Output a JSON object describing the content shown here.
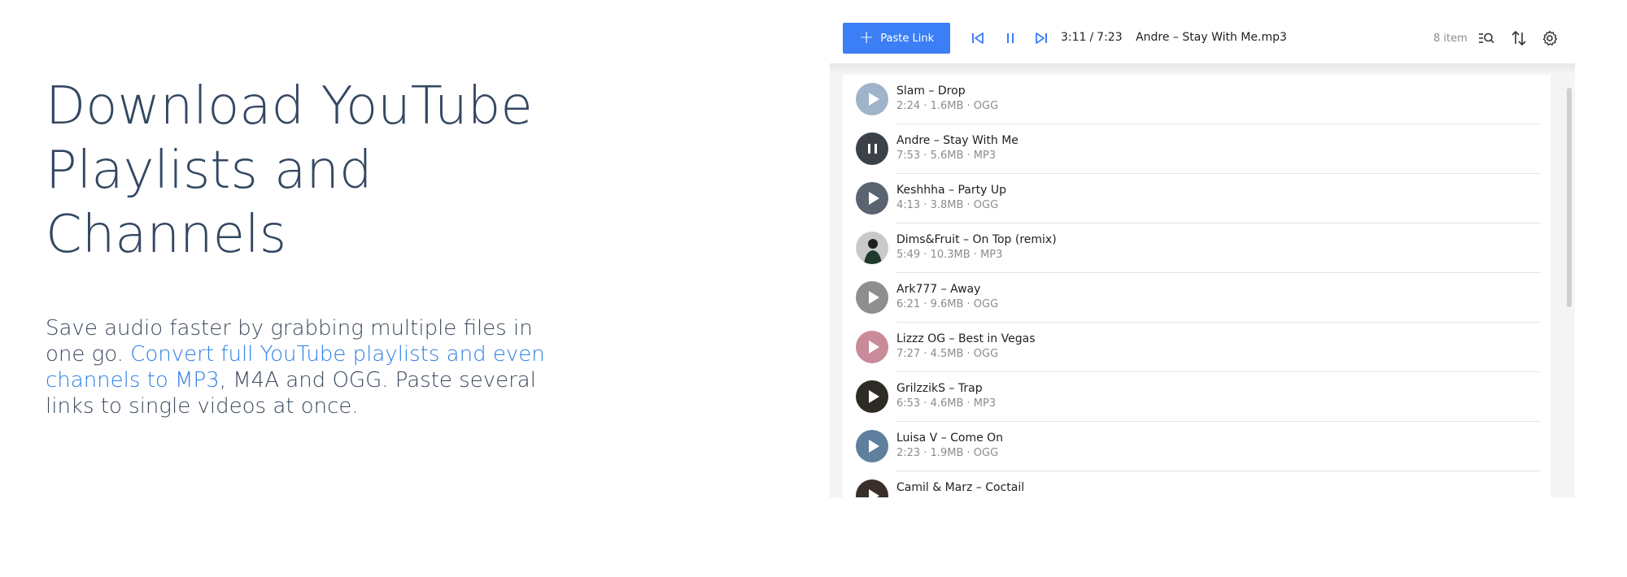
{
  "hero": {
    "title": "Download YouTube Playlists and Channels",
    "text_before": "Save audio faster by grabbing multiple files in one go. ",
    "link_text": "Convert full YouTube playlists and even channels to MP3",
    "text_after": ", M4A and OGG. Paste several links to single videos at once."
  },
  "toolbar": {
    "paste_label": "Paste Link",
    "current_time": "3:11",
    "total_time": "7:23",
    "now_playing": "Andre – Stay With Me.mp3",
    "item_count": "8 item",
    "icons": [
      "previous-icon",
      "pause-icon",
      "next-icon",
      "search-list-icon",
      "sort-icon",
      "gear-icon"
    ]
  },
  "colors": {
    "accent": "#3b7ef5",
    "link": "#2f7fe6",
    "heading": "#334862"
  },
  "tracks": [
    {
      "title": "Slam – Drop",
      "meta": "2:24 · 1.6MB · OGG",
      "state": "play",
      "thumb": "#9fb4c8"
    },
    {
      "title": "Andre – Stay With Me",
      "meta": "7:53 · 5.6MB · MP3",
      "state": "pause",
      "thumb": "#3c4148"
    },
    {
      "title": "Keshhha – Party Up",
      "meta": "4:13 · 3.8MB · OGG",
      "state": "play",
      "thumb": "#5a6470"
    },
    {
      "title": "Dims&Fruit – On Top (remix)",
      "meta": "5:49 · 10.3MB · MP3",
      "state": "person",
      "thumb": "#c9c9c9"
    },
    {
      "title": "Ark777 – Away",
      "meta": "6:21 · 9.6MB · OGG",
      "state": "play",
      "thumb": "#8e8e8e"
    },
    {
      "title": "Lizzz OG – Best in Vegas",
      "meta": "7:27 · 4.5MB · OGG",
      "state": "play",
      "thumb": "#c98a9a"
    },
    {
      "title": "GrilzzikS – Trap",
      "meta": "6:53 · 4.6MB · MP3",
      "state": "play",
      "thumb": "#2e2a26"
    },
    {
      "title": "Luisa V – Come On",
      "meta": "2:23 · 1.9MB · OGG",
      "state": "play",
      "thumb": "#5e7f9e"
    },
    {
      "title": "Camil & Marz – Coctail",
      "meta": "",
      "state": "play",
      "thumb": "#3a2f28"
    }
  ]
}
